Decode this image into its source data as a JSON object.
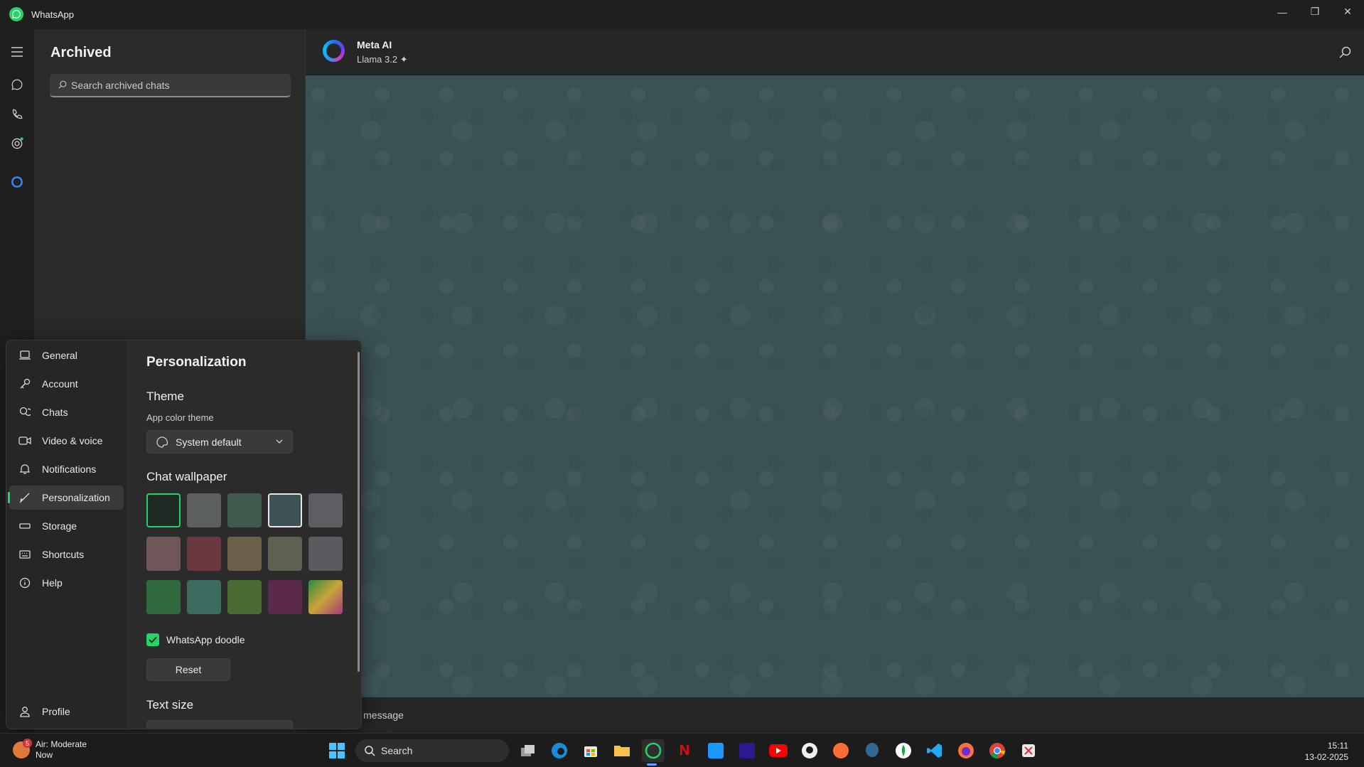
{
  "app": {
    "title": "WhatsApp"
  },
  "archived": {
    "title": "Archived",
    "search_placeholder": "Search archived chats"
  },
  "chat": {
    "name": "Meta AI",
    "subtitle": "Llama 3.2 ✦",
    "compose_placeholder": "pe a message"
  },
  "settings": {
    "nav": [
      {
        "label": "General",
        "icon": "laptop-icon"
      },
      {
        "label": "Account",
        "icon": "key-icon"
      },
      {
        "label": "Chats",
        "icon": "chat-bubbles-icon"
      },
      {
        "label": "Video & voice",
        "icon": "video-icon"
      },
      {
        "label": "Notifications",
        "icon": "bell-icon"
      },
      {
        "label": "Personalization",
        "icon": "brush-icon"
      },
      {
        "label": "Storage",
        "icon": "storage-icon"
      },
      {
        "label": "Shortcuts",
        "icon": "keyboard-icon"
      },
      {
        "label": "Help",
        "icon": "info-icon"
      }
    ],
    "profile_label": "Profile",
    "active_nav": "Personalization",
    "page_title": "Personalization",
    "theme_heading": "Theme",
    "theme_label": "App color theme",
    "theme_value": "System default",
    "wallpaper_heading": "Chat wallpaper",
    "wallpapers": [
      "#1f2a25",
      "#5b605f",
      "#3f5a4c",
      "#3d5358",
      "#5c5e64",
      "#6e5659",
      "#6a3840",
      "#6b6049",
      "#5f5f52",
      "#5a5b5e",
      "#2f6a3f",
      "#3c6b5f",
      "#476b31",
      "#5b2a4a",
      "#c9a43a"
    ],
    "doodle_label": "WhatsApp doodle",
    "reset_label": "Reset",
    "text_size_heading": "Text size"
  },
  "taskbar": {
    "weather_title": "Air: Moderate",
    "weather_sub": "Now",
    "weather_badge": "5",
    "search_label": "Search",
    "time": "15:11",
    "date": "13-02-2025"
  },
  "colors": {
    "accent": "#25d366",
    "wallpaper": "#3a5256"
  }
}
